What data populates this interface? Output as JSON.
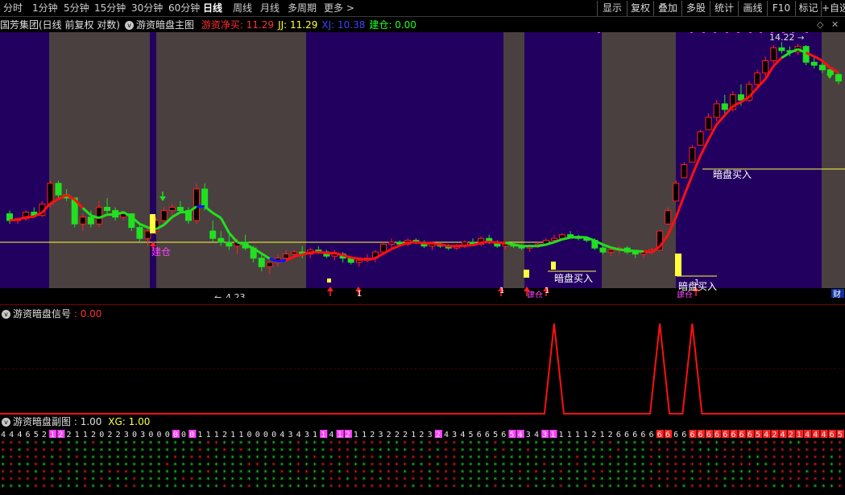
{
  "toolbar": {
    "timeframes": [
      "分时",
      "1分钟",
      "5分钟",
      "15分钟",
      "30分钟",
      "60分钟",
      "日线",
      "周线",
      "月线",
      "多周期",
      "更多 >"
    ],
    "active_timeframe": "日线",
    "buttons": [
      "显示",
      "复权",
      "叠加",
      "多股",
      "统计",
      "画线",
      "F10",
      "标记",
      "+自选"
    ]
  },
  "main_header": {
    "stock": "国芳集团(日线 前复权 对数)",
    "title": "游资暗盘主图",
    "indicators": [
      {
        "label": "游资净买:",
        "value": "11.29",
        "color": "#ff3030"
      },
      {
        "label": "JJ:",
        "value": "11.29",
        "color": "#ffff40"
      },
      {
        "label": "XJ:",
        "value": "10.38",
        "color": "#4040ff"
      },
      {
        "label": "建仓:",
        "value": "0.00",
        "color": "#20ff20"
      }
    ]
  },
  "main_chart": {
    "price_high_label": "14.22",
    "price_low_label": "4.23",
    "annotations": {
      "buy_dark": "暗盘买入",
      "build": "建仓",
      "one": "1",
      "finance": "财"
    }
  },
  "sub1": {
    "title": "游资暗盘信号",
    "value_label": ":",
    "value": "0.00"
  },
  "sub2": {
    "title": "游资暗盘副图",
    "value_label": ":",
    "value": "1.00",
    "xg_label": "XG:",
    "xg_value": "1.00"
  },
  "colors": {
    "up": "#ff2020",
    "down": "#20e020",
    "band_purple": "#22005f",
    "band_gray": "#4a4040",
    "line_red": "#ff1010",
    "line_green": "#20e020",
    "line_blue": "#1010ff",
    "yellow": "#ffff40",
    "magenta": "#ff40ff"
  },
  "chart_data": {
    "type": "candlestick",
    "candles": [
      [
        5.8,
        5.9,
        5.5,
        5.6
      ],
      [
        5.6,
        5.7,
        5.5,
        5.65
      ],
      [
        5.65,
        5.9,
        5.6,
        5.85
      ],
      [
        5.85,
        6.0,
        5.7,
        5.75
      ],
      [
        5.75,
        6.2,
        5.7,
        6.1
      ],
      [
        6.1,
        6.9,
        6.0,
        6.8
      ],
      [
        6.8,
        6.9,
        6.3,
        6.4
      ],
      [
        6.4,
        6.6,
        6.2,
        6.3
      ],
      [
        6.3,
        6.3,
        5.4,
        5.5
      ],
      [
        5.5,
        5.8,
        5.3,
        5.7
      ],
      [
        5.7,
        5.9,
        5.4,
        5.5
      ],
      [
        5.5,
        6.2,
        5.4,
        6.0
      ],
      [
        6.0,
        6.3,
        5.8,
        5.9
      ],
      [
        5.9,
        6.0,
        5.6,
        5.7
      ],
      [
        5.7,
        5.9,
        5.6,
        5.8
      ],
      [
        5.8,
        5.8,
        5.3,
        5.4
      ],
      [
        5.4,
        5.5,
        5.0,
        5.1
      ],
      [
        5.1,
        5.4,
        4.9,
        5.3
      ],
      [
        5.3,
        5.7,
        5.2,
        5.6
      ],
      [
        5.6,
        6.0,
        5.5,
        5.9
      ],
      [
        5.9,
        6.1,
        5.7,
        6.0
      ],
      [
        6.0,
        6.2,
        5.8,
        5.9
      ],
      [
        5.9,
        6.0,
        5.5,
        5.6
      ],
      [
        5.6,
        6.8,
        5.5,
        6.6
      ],
      [
        6.6,
        6.8,
        5.9,
        6.0
      ],
      [
        5.3,
        5.6,
        5.0,
        5.1
      ],
      [
        5.1,
        5.3,
        4.9,
        5.0
      ],
      [
        5.0,
        5.2,
        4.8,
        4.9
      ],
      [
        4.9,
        5.1,
        4.7,
        5.0
      ],
      [
        5.0,
        5.2,
        4.8,
        4.85
      ],
      [
        4.85,
        4.9,
        4.5,
        4.6
      ],
      [
        4.6,
        4.7,
        4.3,
        4.4
      ],
      [
        4.4,
        4.6,
        4.23,
        4.5
      ],
      [
        4.5,
        4.7,
        4.4,
        4.6
      ],
      [
        4.6,
        4.8,
        4.5,
        4.7
      ],
      [
        4.7,
        4.8,
        4.6,
        4.75
      ],
      [
        4.75,
        4.9,
        4.6,
        4.7
      ],
      [
        4.7,
        4.85,
        4.6,
        4.8
      ],
      [
        4.8,
        4.9,
        4.7,
        4.75
      ],
      [
        4.75,
        4.8,
        4.6,
        4.65
      ],
      [
        4.65,
        4.8,
        4.55,
        4.7
      ],
      [
        4.7,
        4.75,
        4.5,
        4.6
      ],
      [
        4.6,
        4.65,
        4.45,
        4.5
      ],
      [
        4.5,
        4.6,
        4.4,
        4.55
      ],
      [
        4.55,
        4.7,
        4.5,
        4.6
      ],
      [
        4.6,
        4.8,
        4.5,
        4.75
      ],
      [
        4.75,
        5.0,
        4.7,
        4.95
      ],
      [
        4.95,
        5.1,
        4.85,
        5.0
      ],
      [
        5.0,
        5.05,
        4.9,
        4.95
      ],
      [
        4.95,
        5.1,
        4.9,
        5.05
      ],
      [
        5.05,
        5.1,
        4.95,
        5.0
      ],
      [
        5.0,
        5.05,
        4.85,
        4.9
      ],
      [
        4.9,
        5.0,
        4.8,
        4.95
      ],
      [
        4.95,
        5.0,
        4.85,
        4.9
      ],
      [
        4.9,
        4.95,
        4.8,
        4.85
      ],
      [
        4.85,
        4.95,
        4.8,
        4.9
      ],
      [
        4.9,
        5.05,
        4.85,
        5.0
      ],
      [
        5.0,
        5.1,
        4.9,
        4.95
      ],
      [
        4.95,
        5.15,
        4.9,
        5.1
      ],
      [
        5.1,
        5.2,
        4.95,
        5.0
      ],
      [
        5.0,
        5.05,
        4.85,
        4.9
      ],
      [
        4.9,
        5.0,
        4.8,
        4.95
      ],
      [
        4.95,
        5.0,
        4.85,
        4.9
      ],
      [
        4.9,
        4.95,
        4.8,
        4.85
      ],
      [
        4.85,
        4.95,
        4.75,
        4.9
      ],
      [
        4.9,
        5.0,
        4.85,
        4.95
      ],
      [
        4.95,
        5.1,
        4.9,
        5.05
      ],
      [
        5.05,
        5.2,
        5.0,
        5.1
      ],
      [
        5.1,
        5.25,
        5.05,
        5.2
      ],
      [
        5.2,
        5.3,
        5.1,
        5.15
      ],
      [
        5.15,
        5.2,
        5.05,
        5.1
      ],
      [
        5.1,
        5.15,
        5.0,
        5.05
      ],
      [
        5.05,
        5.1,
        4.8,
        4.85
      ],
      [
        4.85,
        4.9,
        4.7,
        4.75
      ],
      [
        4.75,
        4.85,
        4.65,
        4.8
      ],
      [
        4.8,
        4.9,
        4.7,
        4.85
      ],
      [
        4.85,
        4.9,
        4.7,
        4.75
      ],
      [
        4.75,
        4.8,
        4.6,
        4.7
      ],
      [
        4.7,
        4.8,
        4.6,
        4.75
      ],
      [
        4.75,
        4.85,
        4.7,
        4.8
      ],
      [
        4.8,
        5.3,
        4.8,
        5.3
      ],
      [
        5.5,
        6.0,
        5.5,
        5.9
      ],
      [
        6.2,
        6.9,
        6.2,
        6.8
      ],
      [
        7.0,
        7.6,
        7.0,
        7.5
      ],
      [
        7.6,
        8.3,
        7.6,
        8.2
      ],
      [
        8.3,
        9.0,
        8.3,
        8.9
      ],
      [
        9.0,
        9.8,
        9.0,
        9.6
      ],
      [
        9.6,
        10.5,
        9.4,
        10.3
      ],
      [
        10.3,
        10.8,
        9.8,
        10.0
      ],
      [
        10.0,
        11.0,
        9.9,
        10.8
      ],
      [
        10.8,
        11.4,
        10.2,
        10.5
      ],
      [
        10.5,
        11.6,
        10.4,
        11.4
      ],
      [
        11.4,
        12.3,
        11.2,
        12.1
      ],
      [
        12.1,
        13.2,
        11.9,
        12.9
      ],
      [
        12.9,
        14.0,
        12.7,
        13.8
      ],
      [
        13.8,
        14.22,
        13.4,
        13.6
      ],
      [
        13.6,
        13.9,
        13.2,
        13.5
      ],
      [
        13.5,
        14.1,
        13.3,
        13.9
      ],
      [
        13.9,
        14.0,
        12.6,
        12.8
      ],
      [
        12.8,
        13.2,
        12.4,
        12.6
      ],
      [
        12.6,
        12.9,
        12.1,
        12.3
      ],
      [
        12.3,
        12.5,
        11.8,
        12.0
      ],
      [
        12.0,
        12.1,
        11.4,
        11.6
      ]
    ],
    "sub1_signal_spikes": [
      67,
      80,
      84
    ],
    "price_high": 14.22,
    "price_low": 4.23
  }
}
